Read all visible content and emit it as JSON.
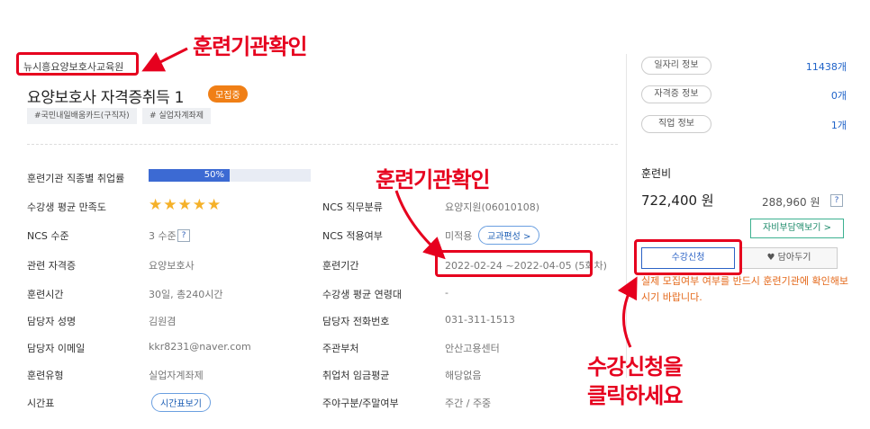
{
  "course": {
    "institution": "뉴시흥요양보호사교육원",
    "title": "요양보호사 자격증취득 1",
    "status_badge": "모집중",
    "tags": [
      "#국민내일배움카드(구직자)",
      "# 실업자계좌제"
    ]
  },
  "details_left": [
    {
      "label": "훈련기관 직종별 취업률",
      "value": ""
    },
    {
      "label": "수강생 평균 만족도",
      "value": ""
    },
    {
      "label": "NCS 수준",
      "value": "3 수준"
    },
    {
      "label": "관련 자격증",
      "value": "요양보호사"
    },
    {
      "label": "훈련시간",
      "value": "30일, 총240시간"
    },
    {
      "label": "담당자 성명",
      "value": "김원겸"
    },
    {
      "label": "담당자 이메일",
      "value": "kkr8231@naver.com"
    },
    {
      "label": "훈련유형",
      "value": "실업자계좌제"
    },
    {
      "label": "시간표",
      "value": ""
    }
  ],
  "employment_rate": {
    "percent": 0.5,
    "label": "50%"
  },
  "satisfaction": {
    "stars": "★★★★★"
  },
  "timetable_button": "시간표보기",
  "details_right": [
    {
      "label": "NCS 직무분류",
      "value": "요양지원(06010108)"
    },
    {
      "label": "NCS 적용여부",
      "value": "미적용"
    },
    {
      "label": "훈련기간",
      "value": "2022-02-24 ~2022-04-05 (5회차)"
    },
    {
      "label": "수강생 평균 연령대",
      "value": "-"
    },
    {
      "label": "담당자 전화번호",
      "value": "031-311-1513"
    },
    {
      "label": "주관부처",
      "value": "안산고용센터"
    },
    {
      "label": "취업처 임금평균",
      "value": "해당없음"
    },
    {
      "label": "주야구분/주말여부",
      "value": "주간 / 주중"
    }
  ],
  "curriculum_button": "교과편성 >",
  "sidebar": {
    "stats": [
      {
        "label": "일자리 정보",
        "count": "11438개"
      },
      {
        "label": "자격증 정보",
        "count": "0개"
      },
      {
        "label": "직업 정보",
        "count": "1개"
      }
    ],
    "fee_title": "훈련비",
    "fee_main": "722,400 원",
    "fee_sub": "288,960 원",
    "self_pay_button": "자비부담액보기 >",
    "apply_button": "수강신청",
    "wish_button": "담아두기",
    "notice": "실제 모집여부 여부를 반드시 훈련기관에 확인해보시기 바랍니다."
  },
  "annotations": {
    "callout_institution": "훈련기관확인",
    "callout_period": "훈련기관확인",
    "callout_apply_line1": "수강신청을",
    "callout_apply_line2": "클릭하세요"
  },
  "colors": {
    "accent": "#3c6ad3",
    "annotation_red": "#e6001e",
    "badge_orange": "#f07f16"
  }
}
